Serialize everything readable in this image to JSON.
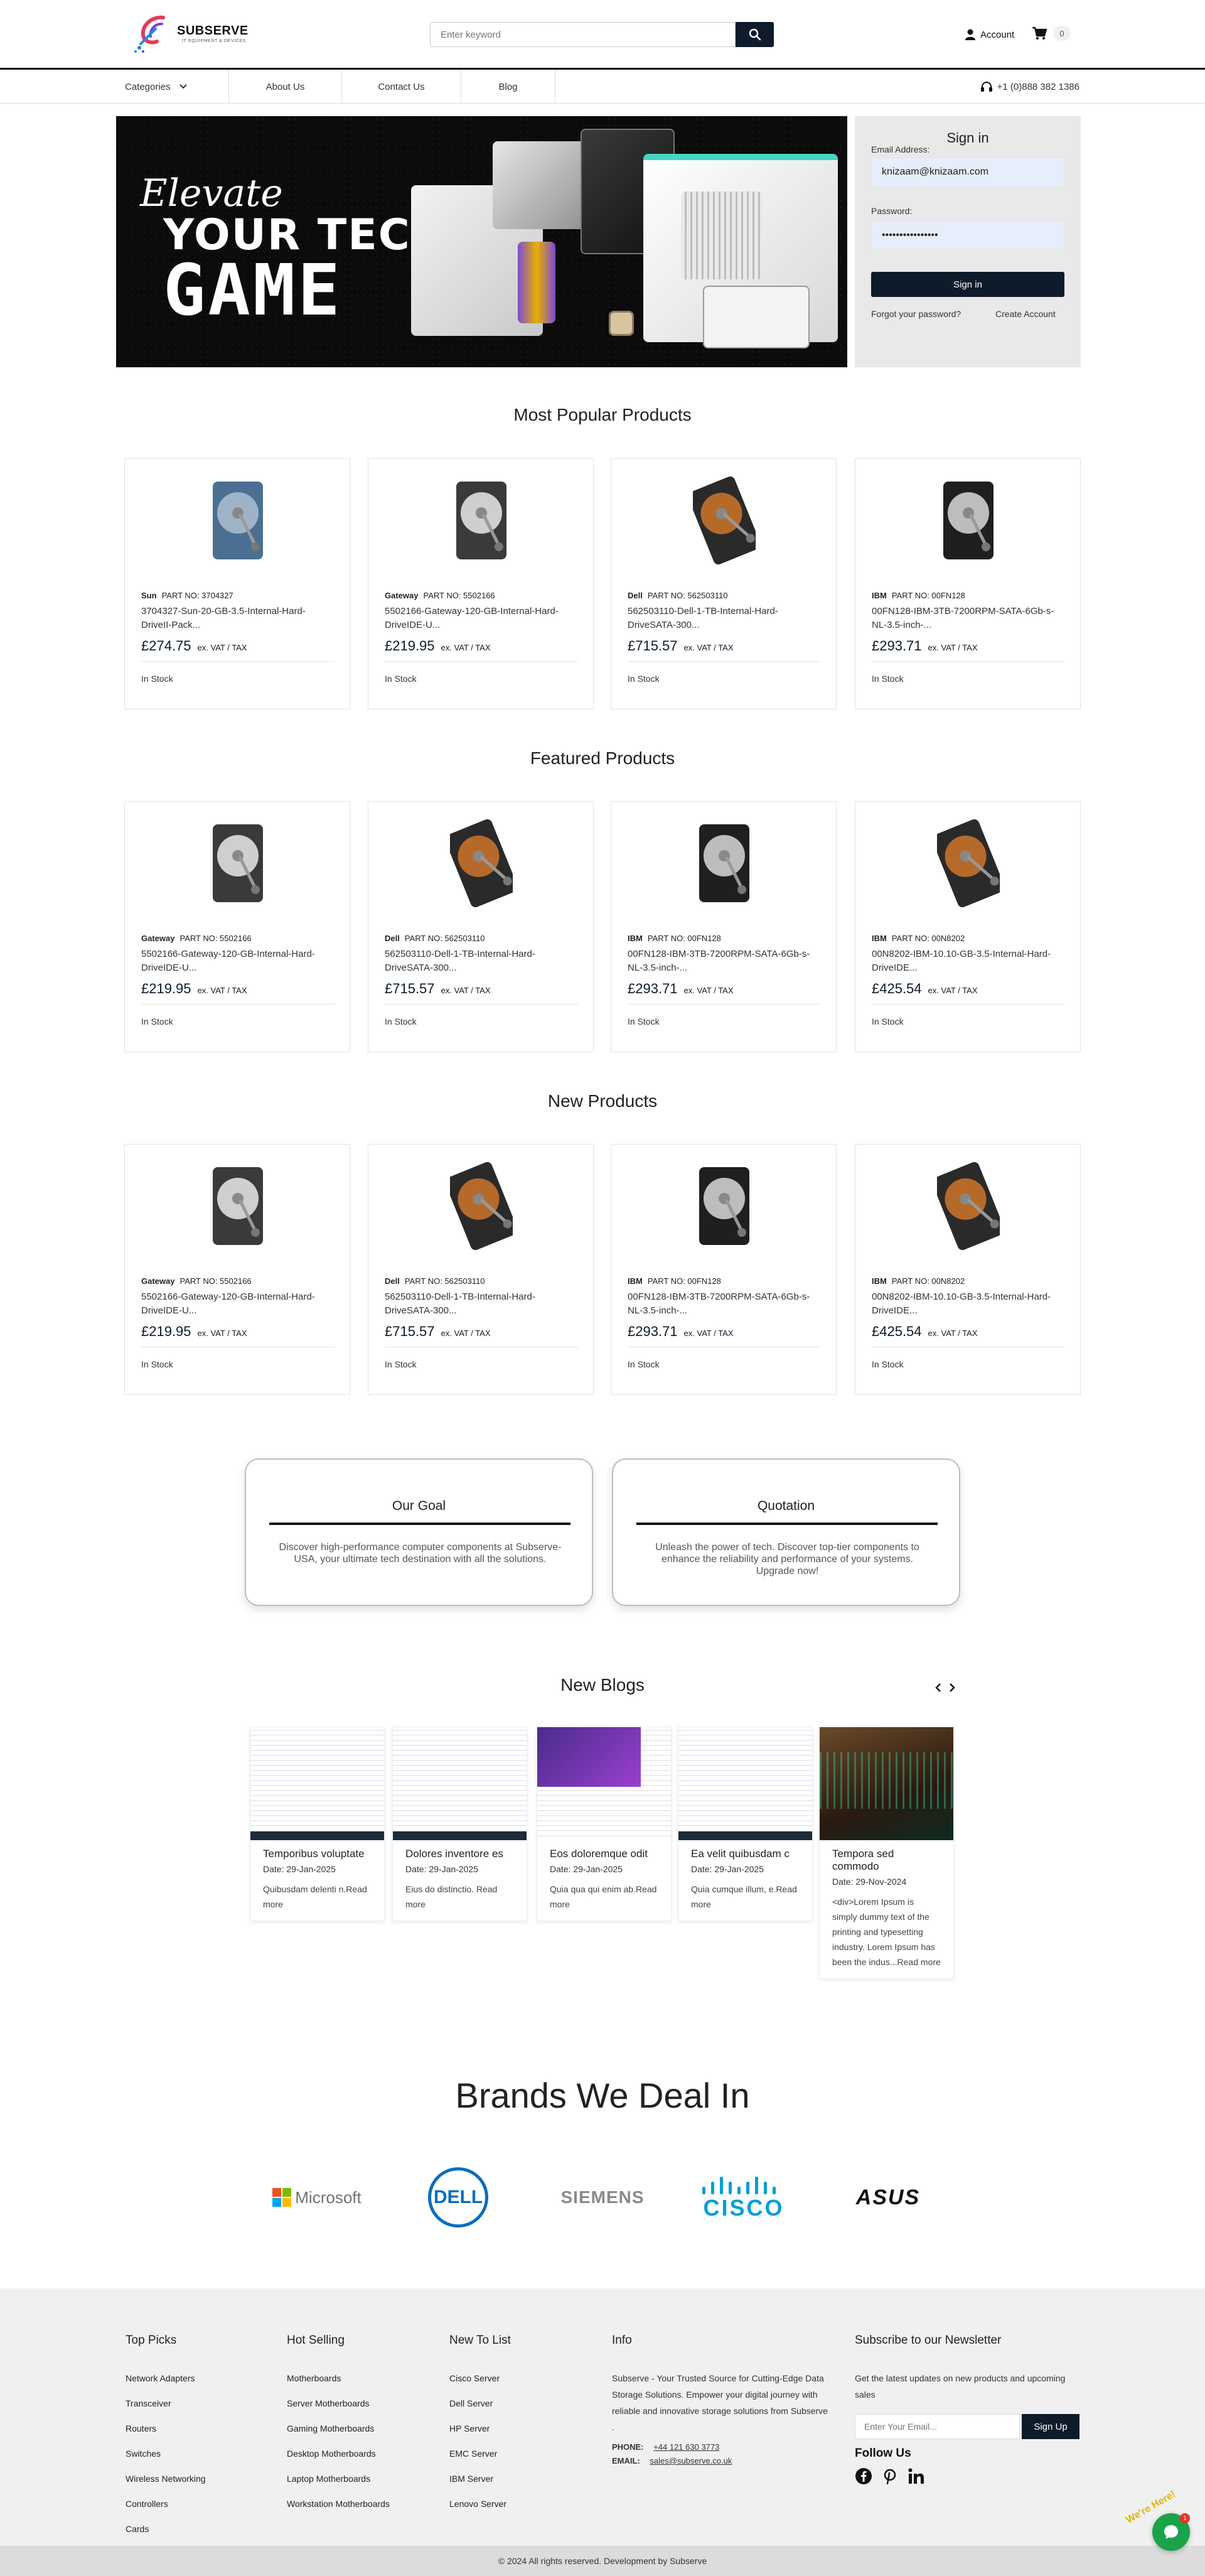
{
  "brand": {
    "name": "SUBSERVE",
    "tagline": "IT EQUIPMENT & DEVICES"
  },
  "header": {
    "search_placeholder": "Enter keyword",
    "account_label": "Account",
    "cart_count": "0"
  },
  "nav": {
    "items": [
      {
        "label": "Categories"
      },
      {
        "label": "About Us"
      },
      {
        "label": "Contact Us"
      },
      {
        "label": "Blog"
      }
    ],
    "phone": "+1 (0)888 382 1386"
  },
  "hero": {
    "script": "Elevate",
    "line1": "YOUR TECH",
    "line2": "GAME"
  },
  "signin": {
    "title": "Sign in",
    "email_label": "Email Address:",
    "email_value": "knizaam@knizaam.com",
    "password_label": "Password:",
    "password_value": "••••••••••••••••",
    "button": "Sign in",
    "forgot": "Forgot your password?",
    "create": "Create Account"
  },
  "sections": {
    "popular": {
      "title": "Most Popular Products",
      "products": [
        {
          "brand": "Sun",
          "part": "PART NO: 3704327",
          "name": "3704327-Sun-20-GB-3.5-Internal-Hard-DriveII-Pack...",
          "price": "£274.75",
          "vat": "ex. VAT / TAX",
          "stock": "In Stock",
          "img": "blue"
        },
        {
          "brand": "Gateway",
          "part": "PART NO: 5502166",
          "name": "5502166-Gateway-120-GB-Internal-Hard-DriveIDE-U...",
          "price": "£219.95",
          "vat": "ex. VAT / TAX",
          "stock": "In Stock",
          "img": "silver"
        },
        {
          "brand": "Dell",
          "part": "PART NO: 562503110",
          "name": "562503110-Dell-1-TB-Internal-Hard-DriveSATA-300...",
          "price": "£715.57",
          "vat": "ex. VAT / TAX",
          "stock": "In Stock",
          "img": "copper"
        },
        {
          "brand": "IBM",
          "part": "PART NO: 00FN128",
          "name": "00FN128-IBM-3TB-7200RPM-SATA-6Gb-s-NL-3.5-inch-...",
          "price": "£293.71",
          "vat": "ex. VAT / TAX",
          "stock": "In Stock",
          "img": "dark"
        }
      ]
    },
    "featured": {
      "title": "Featured Products",
      "products": [
        {
          "brand": "Gateway",
          "part": "PART NO: 5502166",
          "name": "5502166-Gateway-120-GB-Internal-Hard-DriveIDE-U...",
          "price": "£219.95",
          "vat": "ex. VAT / TAX",
          "stock": "In Stock",
          "img": "silver"
        },
        {
          "brand": "Dell",
          "part": "PART NO: 562503110",
          "name": "562503110-Dell-1-TB-Internal-Hard-DriveSATA-300...",
          "price": "£715.57",
          "vat": "ex. VAT / TAX",
          "stock": "In Stock",
          "img": "copper"
        },
        {
          "brand": "IBM",
          "part": "PART NO: 00FN128",
          "name": "00FN128-IBM-3TB-7200RPM-SATA-6Gb-s-NL-3.5-inch-...",
          "price": "£293.71",
          "vat": "ex. VAT / TAX",
          "stock": "In Stock",
          "img": "dark"
        },
        {
          "brand": "IBM",
          "part": "PART NO: 00N8202",
          "name": "00N8202-IBM-10.10-GB-3.5-Internal-Hard-DriveIDE...",
          "price": "£425.54",
          "vat": "ex. VAT / TAX",
          "stock": "In Stock",
          "img": "copper"
        }
      ]
    },
    "new": {
      "title": "New Products",
      "products": [
        {
          "brand": "Gateway",
          "part": "PART NO: 5502166",
          "name": "5502166-Gateway-120-GB-Internal-Hard-DriveIDE-U...",
          "price": "£219.95",
          "vat": "ex. VAT / TAX",
          "stock": "In Stock",
          "img": "silver"
        },
        {
          "brand": "Dell",
          "part": "PART NO: 562503110",
          "name": "562503110-Dell-1-TB-Internal-Hard-DriveSATA-300...",
          "price": "£715.57",
          "vat": "ex. VAT / TAX",
          "stock": "In Stock",
          "img": "copper"
        },
        {
          "brand": "IBM",
          "part": "PART NO: 00FN128",
          "name": "00FN128-IBM-3TB-7200RPM-SATA-6Gb-s-NL-3.5-inch-...",
          "price": "£293.71",
          "vat": "ex. VAT / TAX",
          "stock": "In Stock",
          "img": "dark"
        },
        {
          "brand": "IBM",
          "part": "PART NO: 00N8202",
          "name": "00N8202-IBM-10.10-GB-3.5-Internal-Hard-DriveIDE...",
          "price": "£425.54",
          "vat": "ex. VAT / TAX",
          "stock": "In Stock",
          "img": "copper"
        }
      ]
    }
  },
  "info_cards": [
    {
      "title": "Our Goal",
      "text": "Discover high-performance computer components at Subserve-USA, your ultimate tech destination with all the solutions."
    },
    {
      "title": "Quotation",
      "text": "Unleash the power of tech. Discover top-tier components to enhance the reliability and performance of your systems. Upgrade now!"
    }
  ],
  "blogs": {
    "title": "New Blogs",
    "items": [
      {
        "title": "Temporibus voluptate",
        "date": "Date: 29-Jan-2025",
        "excerpt": "Quibusdam delenti n.Read more",
        "thumb": "doc"
      },
      {
        "title": "Dolores inventore es",
        "date": "Date: 29-Jan-2025",
        "excerpt": "Eius do distinctio. Read more",
        "thumb": "doc"
      },
      {
        "title": "Eos doloremque odit",
        "date": "Date: 29-Jan-2025",
        "excerpt": "Quia qua qui enim ab.Read more",
        "thumb": "web"
      },
      {
        "title": "Ea velit quibusdam c",
        "date": "Date: 29-Jan-2025",
        "excerpt": "Quia cumque illum, e.Read more",
        "thumb": "doc"
      },
      {
        "title": "Tempora sed commodo",
        "date": "Date: 29-Nov-2024",
        "excerpt": "<div>Lorem Ipsum is simply dummy text of the printing and typesetting industry. Lorem Ipsum has been the indus...Read more",
        "thumb": "photo"
      }
    ]
  },
  "brands": {
    "title": "Brands We Deal In",
    "items": [
      "Microsoft",
      "DELL",
      "SIEMENS",
      "CISCO",
      "ASUS"
    ]
  },
  "footer": {
    "columns": [
      {
        "title": "Top Picks",
        "links": [
          "Network Adapters",
          "Transceiver",
          "Routers",
          "Switches",
          "Wireless Networking",
          "Controllers",
          "Cards"
        ]
      },
      {
        "title": "Hot Selling",
        "links": [
          "Motherboards",
          "Server Motherboards",
          "Gaming Motherboards",
          "Desktop Motherboards",
          "Laptop Motherboards",
          "Workstation Motherboards"
        ]
      },
      {
        "title": "New To List",
        "links": [
          "Cisco Server",
          "Dell Server",
          "HP Server",
          "EMC Server",
          "IBM Server",
          "Lenovo Server"
        ]
      }
    ],
    "info": {
      "title": "Info",
      "text": "Subserve - Your Trusted Source for Cutting-Edge Data Storage Solutions. Empower your digital journey with reliable and innovative storage solutions from Subserve .",
      "phone_label": "PHONE:",
      "phone": "+44 121 630 3773",
      "email_label": "EMAIL:",
      "email": "sales@subserve.co.uk"
    },
    "newsletter": {
      "title": "Subscribe to our Newsletter",
      "text": "Get the latest updates on new products and upcoming sales",
      "placeholder": "Enter Your Email...",
      "button": "Sign Up",
      "follow": "Follow Us"
    },
    "copyright": "© 2024 All rights reserved. Development by Subserve"
  },
  "chat": {
    "bubble": "We're Here!",
    "badge": "1"
  }
}
